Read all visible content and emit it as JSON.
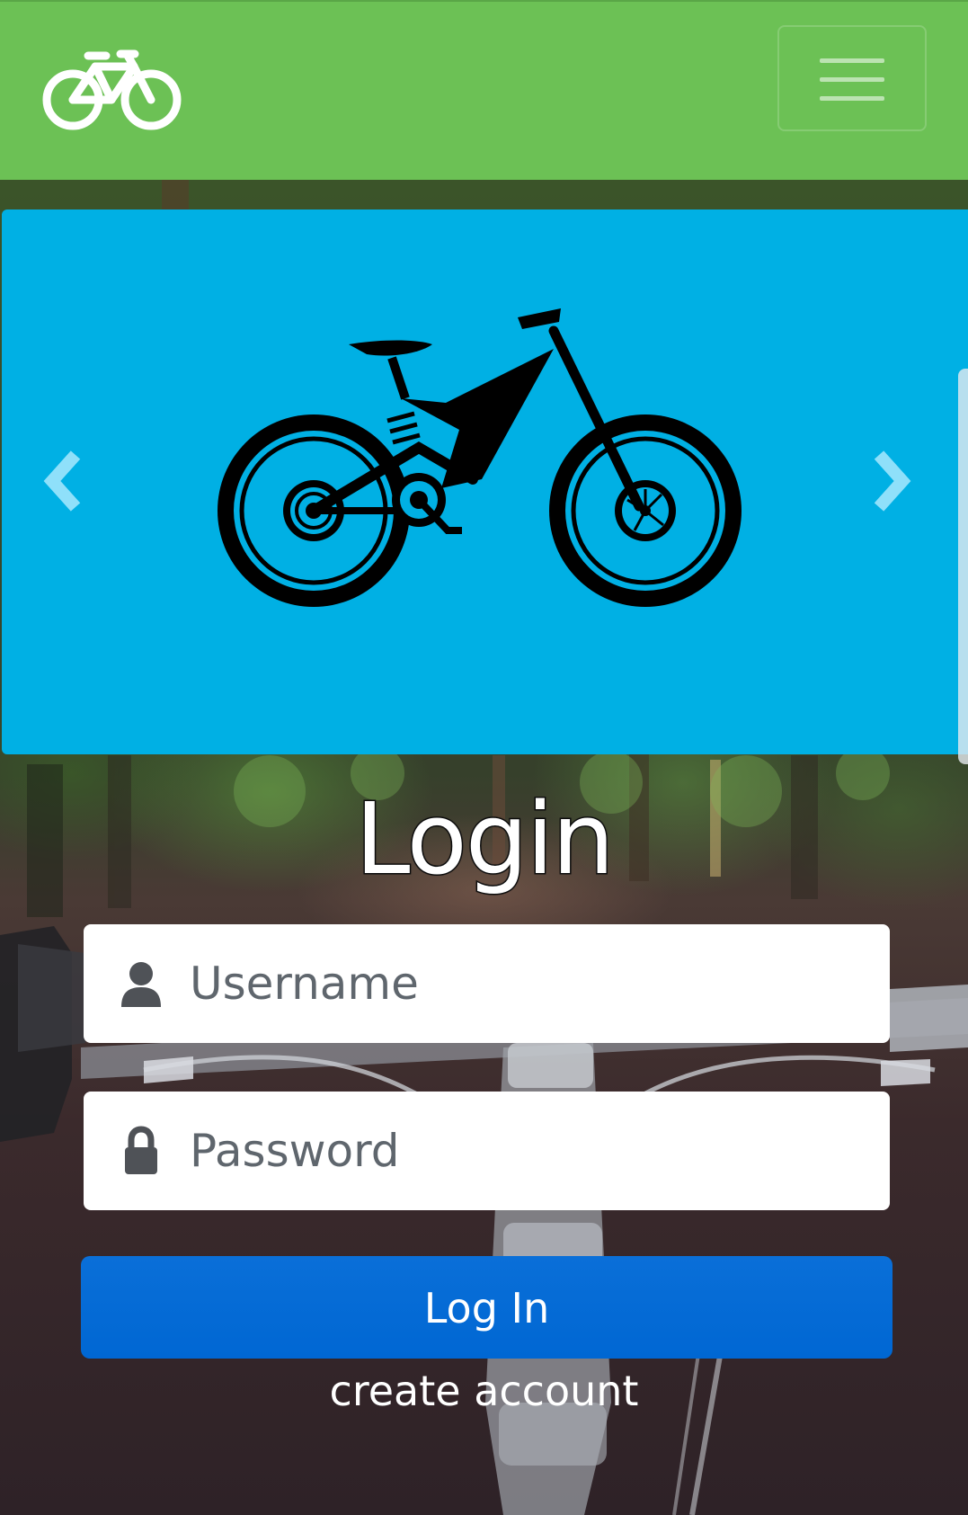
{
  "navbar": {
    "brand_icon": "bicycle-icon",
    "toggler_icon": "hamburger-menu-icon",
    "color": "#6cc155"
  },
  "carousel": {
    "background_color": "#00b0e4",
    "slide_image": "mountain-bike-illustration",
    "prev_icon": "chevron-left-icon",
    "next_icon": "chevron-right-icon"
  },
  "login": {
    "title": "Login",
    "username": {
      "icon": "user-icon",
      "placeholder": "Username",
      "value": ""
    },
    "password": {
      "icon": "lock-icon",
      "placeholder": "Password",
      "value": ""
    },
    "submit_label": "Log In",
    "create_account_label": "create account",
    "button_color": "#0067d3"
  }
}
